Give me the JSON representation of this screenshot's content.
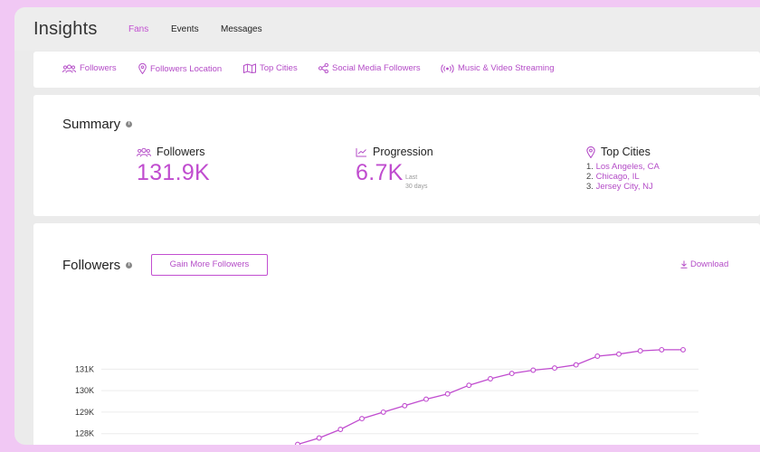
{
  "header": {
    "title": "Insights",
    "tabs": [
      {
        "label": "Fans",
        "active": true
      },
      {
        "label": "Events",
        "active": false
      },
      {
        "label": "Messages",
        "active": false
      }
    ]
  },
  "subnav": {
    "items": [
      {
        "label": "Followers",
        "icon": "people-icon"
      },
      {
        "label": "Followers Location",
        "icon": "map-pin-icon"
      },
      {
        "label": "Top Cities",
        "icon": "city-map-icon"
      },
      {
        "label": "Social Media Followers",
        "icon": "share-icon"
      },
      {
        "label": "Music & Video Streaming",
        "icon": "broadcast-icon"
      }
    ]
  },
  "summary": {
    "title": "Summary",
    "followers": {
      "label": "Followers",
      "value": "131.9K"
    },
    "progression": {
      "label": "Progression",
      "value": "6.7K",
      "sub_line1": "Last",
      "sub_line2": "30 days"
    },
    "top_cities": {
      "label": "Top Cities",
      "items": [
        {
          "num": "1.",
          "name": "Los Angeles, CA"
        },
        {
          "num": "2.",
          "name": "Chicago, IL"
        },
        {
          "num": "3.",
          "name": "Jersey City, NJ"
        }
      ]
    }
  },
  "followers_section": {
    "title": "Followers",
    "gain_button": "Gain More Followers",
    "download": "Download"
  },
  "colors": {
    "accent": "#c04ccf",
    "background": "#f1c8f4"
  },
  "chart_data": {
    "type": "line",
    "ytick_labels": [
      "131K",
      "130K",
      "129K",
      "128K"
    ],
    "yticks": [
      131,
      130,
      129,
      128
    ],
    "ylim": [
      127.4,
      132.4
    ],
    "grid": true,
    "series": [
      {
        "values": [
          127.5,
          127.8,
          128.2,
          128.7,
          129.0,
          129.3,
          129.6,
          129.85,
          130.25,
          130.55,
          130.8,
          130.95,
          131.05,
          131.2,
          131.6,
          131.7,
          131.85,
          131.9,
          131.9
        ]
      }
    ]
  }
}
